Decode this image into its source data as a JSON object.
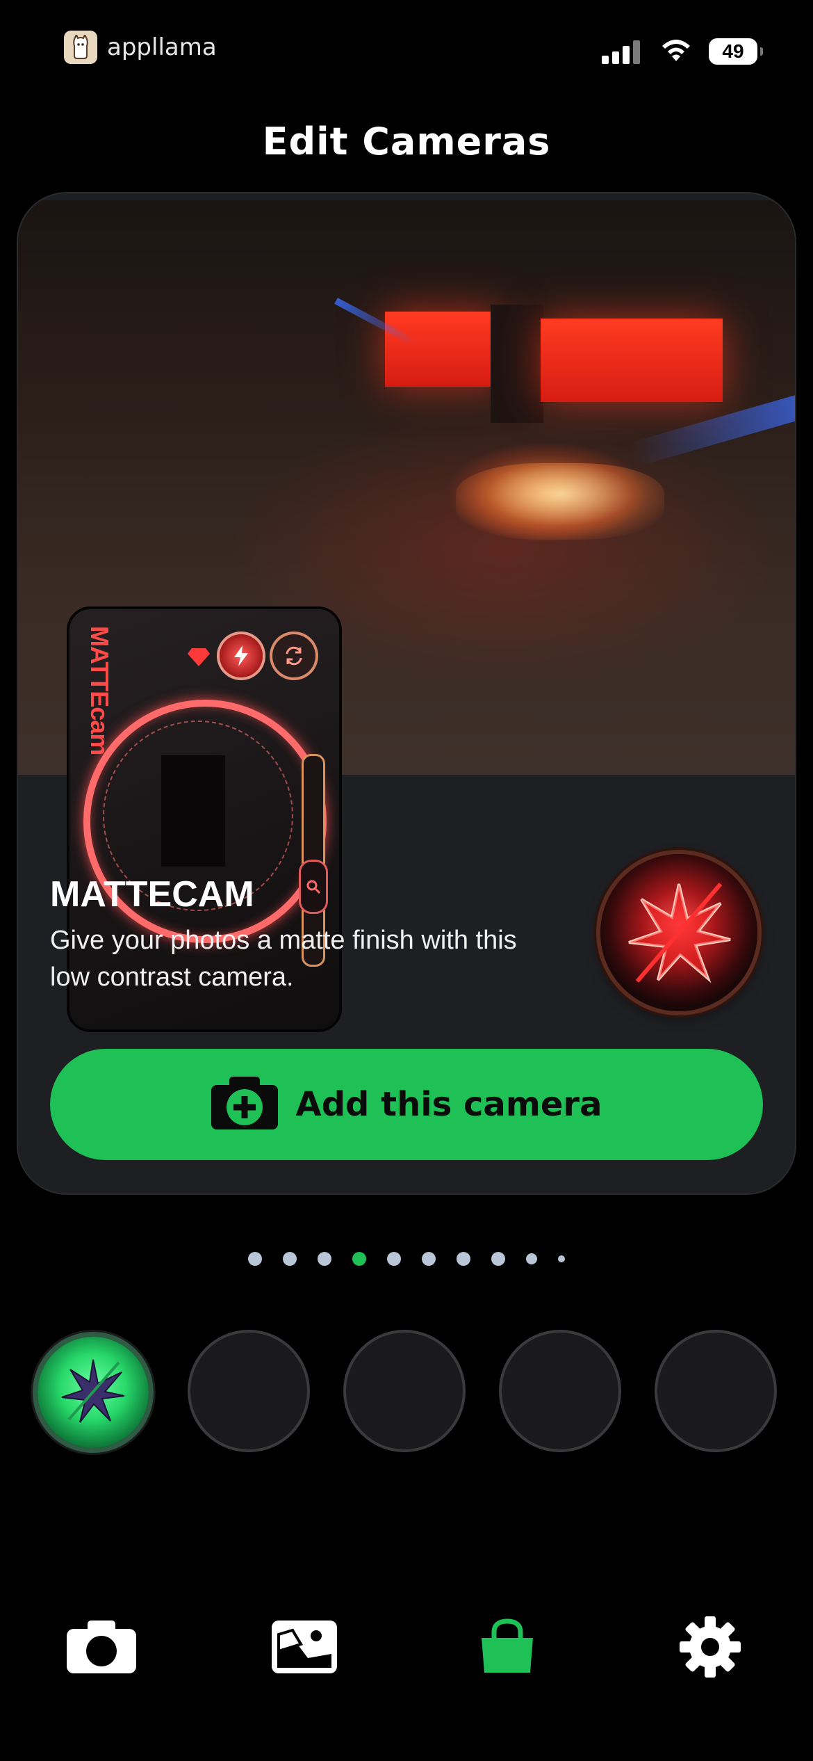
{
  "status_bar": {
    "brand": "appllama",
    "battery": "49"
  },
  "page": {
    "title": "Edit Cameras"
  },
  "camera_card": {
    "phone_logo": "MATTEcam",
    "name": "MATTECAM",
    "description": "Give your photos a matte finish with this low contrast camera.",
    "add_button_label": "Add this camera"
  },
  "pager": {
    "total": 10,
    "active_index": 3
  },
  "camera_slots": {
    "filled_count": 1,
    "total": 5
  },
  "tab_bar": {
    "items": [
      {
        "icon": "camera-icon",
        "active": false
      },
      {
        "icon": "gallery-icon",
        "active": false
      },
      {
        "icon": "shopping-bag-icon",
        "active": true
      },
      {
        "icon": "gear-icon",
        "active": false
      }
    ]
  },
  "colors": {
    "accent_green": "#1fc055",
    "card_bg": "#1e1f23",
    "badge_red": "#e0282a",
    "pager_dot": "#b8c6d8"
  }
}
